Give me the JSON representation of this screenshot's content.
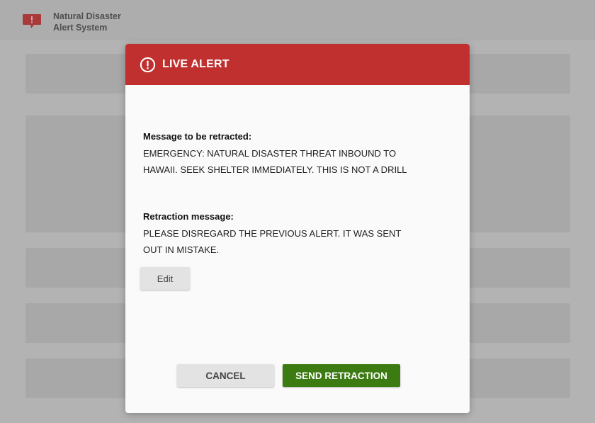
{
  "app": {
    "title_line1": "Natural Disaster",
    "title_line2": "Alert System",
    "logo_icon": "alert-speech-bubble-icon"
  },
  "modal": {
    "title": "LIVE ALERT",
    "header_icon": "exclamation-circle-icon",
    "header_color": "#c0302f",
    "retracted_label": "Message to be retracted:",
    "retracted_line1": "EMERGENCY: NATURAL DISASTER THREAT INBOUND TO",
    "retracted_line2": "HAWAII. SEEK SHELTER IMMEDIATELY.  THIS IS NOT A DRILL",
    "retraction_label": "Retraction message:",
    "retraction_line1": "PLEASE DISREGARD THE PREVIOUS ALERT. IT WAS SENT",
    "retraction_line2": "OUT IN MISTAKE.",
    "edit_label": "Edit",
    "cancel_label": "CANCEL",
    "send_label": "SEND RETRACTION",
    "send_color": "#3c7a12"
  }
}
